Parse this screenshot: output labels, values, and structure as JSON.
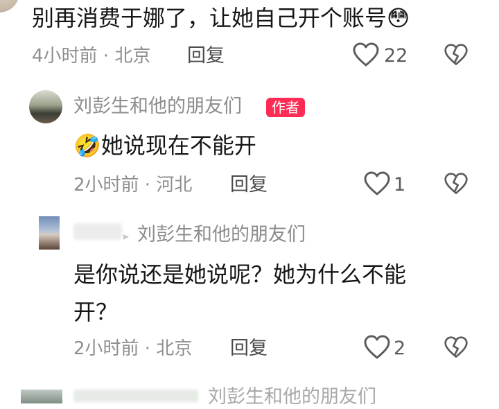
{
  "comment_top": {
    "text": "别再消费于娜了，让她自己开个账号",
    "emoji": "😳",
    "time_location": "4小时前 · 北京",
    "reply_label": "回复",
    "like_count": "22"
  },
  "reply_1": {
    "author": "刘彭生和他的朋友们",
    "author_badge": "作者",
    "emoji": "🤣",
    "text": "她说现在不能开",
    "time_location": "2小时前 · 河北",
    "reply_label": "回复",
    "like_count": "1"
  },
  "reply_2": {
    "reply_to_arrow": "▸",
    "reply_to": "刘彭生和他的朋友们",
    "text_line1": "是你说还是她说呢？她为什么不能",
    "text_line2": "开？",
    "time_location": "2小时前 · 北京",
    "reply_label": "回复",
    "like_count": "2"
  },
  "reply_3_partial": {
    "text": "刘彭生和他的朋友们"
  },
  "icons": {
    "like": "heart-outline-icon",
    "dislike": "broken-heart-icon"
  }
}
